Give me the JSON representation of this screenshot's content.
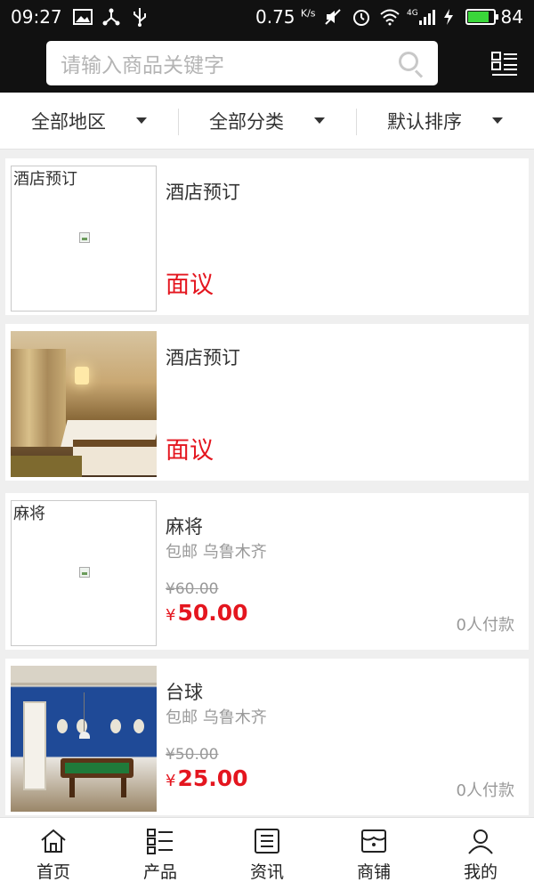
{
  "status_bar": {
    "time": "09:27",
    "speed": "0.75",
    "speed_unit": "K/s",
    "battery": "84",
    "battery_level": 0.84,
    "network": "4G"
  },
  "search": {
    "placeholder": "请输入商品关键字"
  },
  "filters": [
    {
      "label": "全部地区"
    },
    {
      "label": "全部分类"
    },
    {
      "label": "默认排序"
    }
  ],
  "products": [
    {
      "name": "酒店预订",
      "image_alt": "酒店预订",
      "price_text": "面议"
    },
    {
      "name": "酒店预订",
      "price_text": "面议"
    },
    {
      "name": "麻将",
      "image_alt": "麻将",
      "shipping": "包邮 乌鲁木齐",
      "old_price": "¥60.00",
      "currency": "¥",
      "price": "50.00",
      "paid": "0人付款"
    },
    {
      "name": "台球",
      "shipping": "包邮 乌鲁木齐",
      "old_price": "¥50.00",
      "currency": "¥",
      "price": "25.00",
      "paid": "0人付款"
    }
  ],
  "bottom_nav": [
    {
      "label": "首页",
      "icon": "home-icon"
    },
    {
      "label": "产品",
      "icon": "list-icon"
    },
    {
      "label": "资讯",
      "icon": "news-icon"
    },
    {
      "label": "商铺",
      "icon": "shop-icon"
    },
    {
      "label": "我的",
      "icon": "user-icon"
    }
  ]
}
